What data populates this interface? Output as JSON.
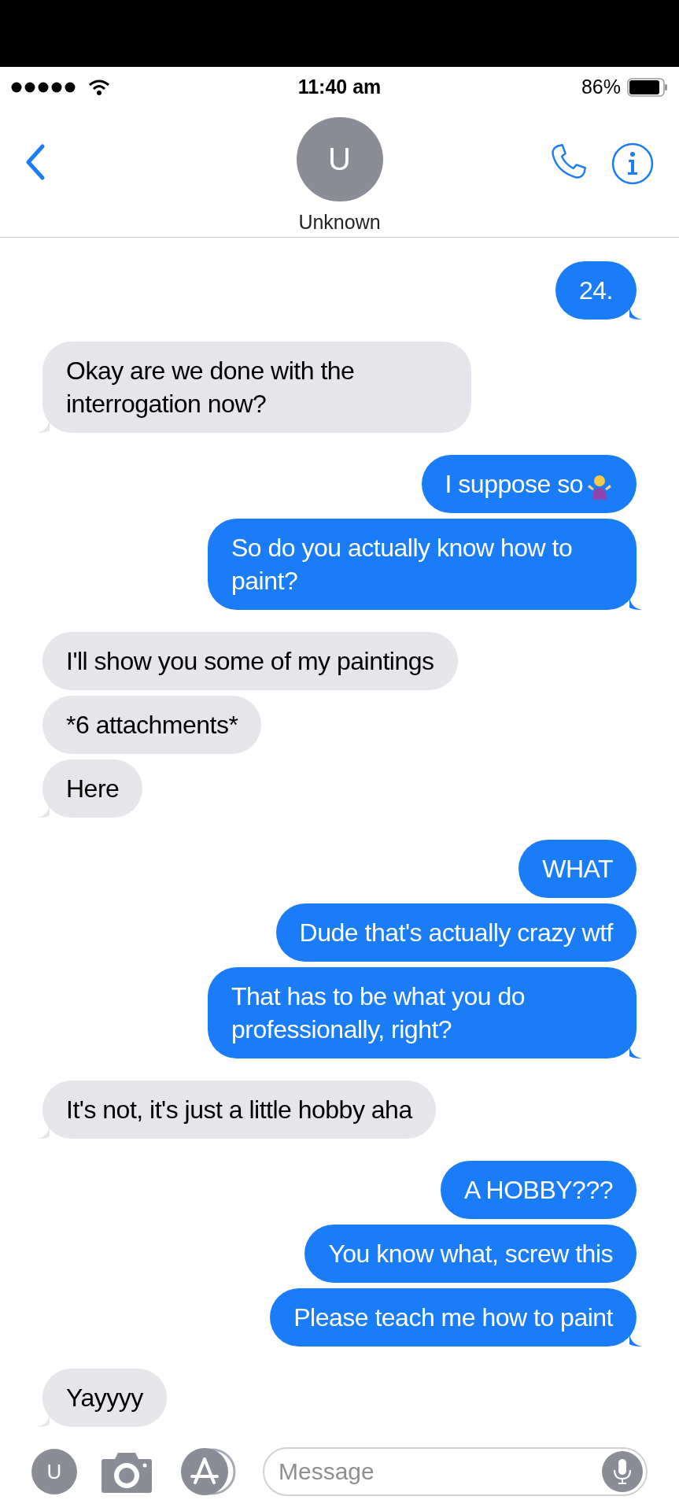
{
  "status_bar": {
    "time": "11:40 am",
    "battery": "86%"
  },
  "contact": {
    "initial": "U",
    "name": "Unknown"
  },
  "messages": [
    {
      "kind": "sent",
      "text": "24.",
      "tail": true
    },
    {
      "kind": "received",
      "text": "Okay are we done with the interrogation now?",
      "tail": true
    },
    {
      "kind": "sent",
      "text": "I suppose so",
      "tail": false,
      "shrug": true
    },
    {
      "kind": "sent",
      "text": "So do you actually know how to paint?",
      "tail": true
    },
    {
      "kind": "received",
      "text": "I'll show you some of my paintings",
      "tail": false
    },
    {
      "kind": "received",
      "text": "*6 attachments*",
      "tail": false
    },
    {
      "kind": "received",
      "text": "Here",
      "tail": true
    },
    {
      "kind": "sent",
      "text": "WHAT",
      "tail": false
    },
    {
      "kind": "sent",
      "text": "Dude that's actually crazy wtf",
      "tail": false
    },
    {
      "kind": "sent",
      "text": "That has to be what you do professionally, right?",
      "tail": true
    },
    {
      "kind": "received",
      "text": "It's not, it's just a little hobby aha",
      "tail": true
    },
    {
      "kind": "sent",
      "text": "A HOBBY???",
      "tail": false
    },
    {
      "kind": "sent",
      "text": "You know what, screw this",
      "tail": false
    },
    {
      "kind": "sent",
      "text": "Please teach me how to paint",
      "tail": true
    },
    {
      "kind": "received",
      "text": "Yayyyy",
      "tail": true
    }
  ],
  "composer": {
    "avatar_initial": "U",
    "placeholder": "Message"
  }
}
